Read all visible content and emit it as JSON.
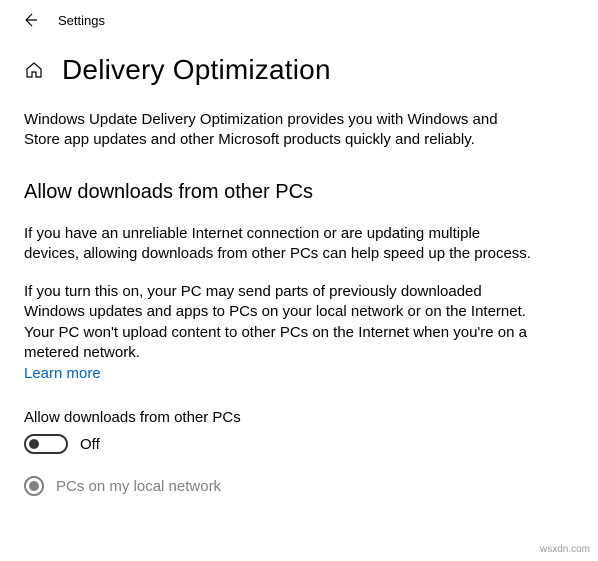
{
  "header": {
    "app_title": "Settings"
  },
  "page": {
    "title": "Delivery Optimization",
    "description": "Windows Update Delivery Optimization provides you with Windows and Store app updates and other Microsoft products quickly and reliably."
  },
  "section": {
    "heading": "Allow downloads from other PCs",
    "para1": "If you have an unreliable Internet connection or are updating multiple devices, allowing downloads from other PCs can help speed up the process.",
    "para2": "If you turn this on, your PC may send parts of previously downloaded Windows updates and apps to PCs on your local network or on the Internet. Your PC won't upload content to other PCs on the Internet when you're on a metered network.",
    "learn_more": "Learn more"
  },
  "toggle": {
    "label": "Allow downloads from other PCs",
    "state": "Off"
  },
  "radio": {
    "option1": "PCs on my local network"
  },
  "watermark": "wsxdn.com"
}
